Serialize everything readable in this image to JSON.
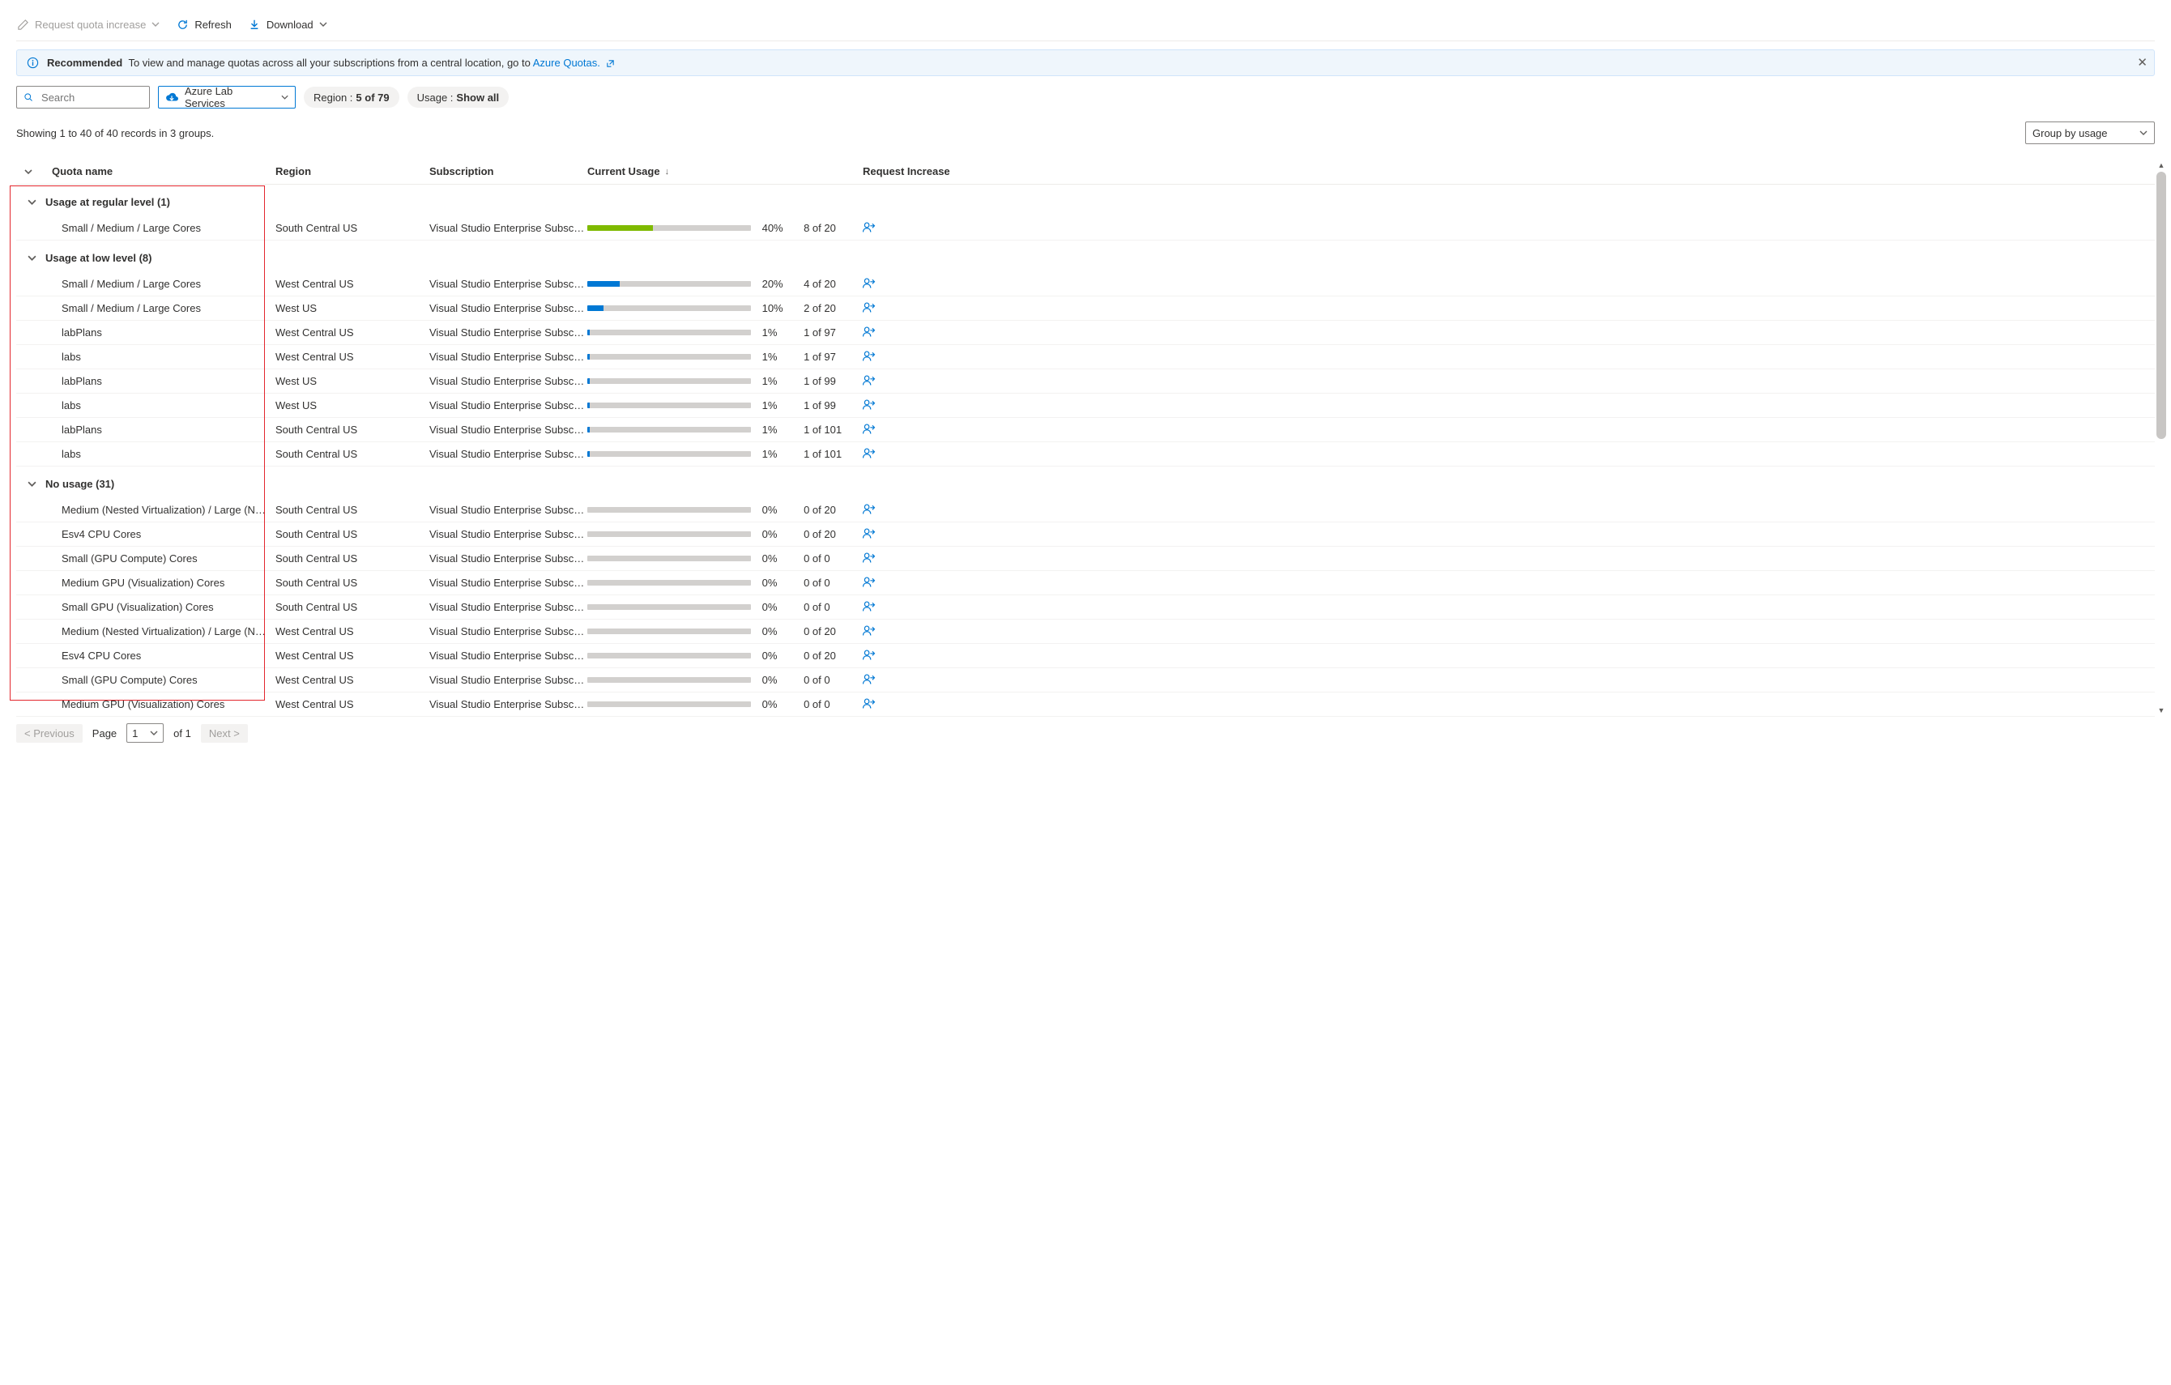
{
  "toolbar": {
    "request_increase": "Request quota increase",
    "refresh": "Refresh",
    "download": "Download"
  },
  "banner": {
    "label": "Recommended",
    "text": "To view and manage quotas across all your subscriptions from a central location, go to ",
    "link": "Azure Quotas."
  },
  "filters": {
    "search_placeholder": "Search",
    "provider": "Azure Lab Services",
    "region_label": "Region : ",
    "region_value": "5 of 79",
    "usage_label": "Usage : ",
    "usage_value": "Show all"
  },
  "status": {
    "showing": "Showing 1 to 40 of 40 records in 3 groups.",
    "group_by": "Group by usage"
  },
  "columns": {
    "name": "Quota name",
    "region": "Region",
    "subscription": "Subscription",
    "usage": "Current Usage",
    "request": "Request Increase"
  },
  "groups": [
    {
      "title": "Usage at regular level (1)",
      "rows": [
        {
          "name": "Small / Medium / Large Cores",
          "region": "South Central US",
          "sub": "Visual Studio Enterprise Subscri…",
          "pct": 40,
          "used": "8 of 20",
          "color": "#7fba00"
        }
      ]
    },
    {
      "title": "Usage at low level (8)",
      "rows": [
        {
          "name": "Small / Medium / Large Cores",
          "region": "West Central US",
          "sub": "Visual Studio Enterprise Subscri…",
          "pct": 20,
          "used": "4 of 20",
          "color": "#0078d4"
        },
        {
          "name": "Small / Medium / Large Cores",
          "region": "West US",
          "sub": "Visual Studio Enterprise Subscri…",
          "pct": 10,
          "used": "2 of 20",
          "color": "#0078d4"
        },
        {
          "name": "labPlans",
          "region": "West Central US",
          "sub": "Visual Studio Enterprise Subscri…",
          "pct": 1,
          "used": "1 of 97",
          "color": "#0078d4"
        },
        {
          "name": "labs",
          "region": "West Central US",
          "sub": "Visual Studio Enterprise Subscri…",
          "pct": 1,
          "used": "1 of 97",
          "color": "#0078d4"
        },
        {
          "name": "labPlans",
          "region": "West US",
          "sub": "Visual Studio Enterprise Subscri…",
          "pct": 1,
          "used": "1 of 99",
          "color": "#0078d4"
        },
        {
          "name": "labs",
          "region": "West US",
          "sub": "Visual Studio Enterprise Subscri…",
          "pct": 1,
          "used": "1 of 99",
          "color": "#0078d4"
        },
        {
          "name": "labPlans",
          "region": "South Central US",
          "sub": "Visual Studio Enterprise Subscri…",
          "pct": 1,
          "used": "1 of 101",
          "color": "#0078d4"
        },
        {
          "name": "labs",
          "region": "South Central US",
          "sub": "Visual Studio Enterprise Subscri…",
          "pct": 1,
          "used": "1 of 101",
          "color": "#0078d4"
        }
      ]
    },
    {
      "title": "No usage (31)",
      "rows": [
        {
          "name": "Medium (Nested Virtualization) / Large (Nested …",
          "region": "South Central US",
          "sub": "Visual Studio Enterprise Subscri…",
          "pct": 0,
          "used": "0 of 20",
          "color": "#0078d4"
        },
        {
          "name": "Esv4 CPU Cores",
          "region": "South Central US",
          "sub": "Visual Studio Enterprise Subscri…",
          "pct": 0,
          "used": "0 of 20",
          "color": "#0078d4"
        },
        {
          "name": "Small (GPU Compute) Cores",
          "region": "South Central US",
          "sub": "Visual Studio Enterprise Subscri…",
          "pct": 0,
          "used": "0 of 0",
          "color": "#0078d4"
        },
        {
          "name": "Medium GPU (Visualization) Cores",
          "region": "South Central US",
          "sub": "Visual Studio Enterprise Subscri…",
          "pct": 0,
          "used": "0 of 0",
          "color": "#0078d4"
        },
        {
          "name": "Small GPU (Visualization) Cores",
          "region": "South Central US",
          "sub": "Visual Studio Enterprise Subscri…",
          "pct": 0,
          "used": "0 of 0",
          "color": "#0078d4"
        },
        {
          "name": "Medium (Nested Virtualization) / Large (Nested …",
          "region": "West Central US",
          "sub": "Visual Studio Enterprise Subscri…",
          "pct": 0,
          "used": "0 of 20",
          "color": "#0078d4"
        },
        {
          "name": "Esv4 CPU Cores",
          "region": "West Central US",
          "sub": "Visual Studio Enterprise Subscri…",
          "pct": 0,
          "used": "0 of 20",
          "color": "#0078d4"
        },
        {
          "name": "Small (GPU Compute) Cores",
          "region": "West Central US",
          "sub": "Visual Studio Enterprise Subscri…",
          "pct": 0,
          "used": "0 of 0",
          "color": "#0078d4"
        },
        {
          "name": "Medium GPU (Visualization) Cores",
          "region": "West Central US",
          "sub": "Visual Studio Enterprise Subscri…",
          "pct": 0,
          "used": "0 of 0",
          "color": "#0078d4"
        }
      ]
    }
  ],
  "pager": {
    "prev": "< Previous",
    "page_label": "Page",
    "page": "1",
    "of": "of 1",
    "next": "Next >"
  }
}
